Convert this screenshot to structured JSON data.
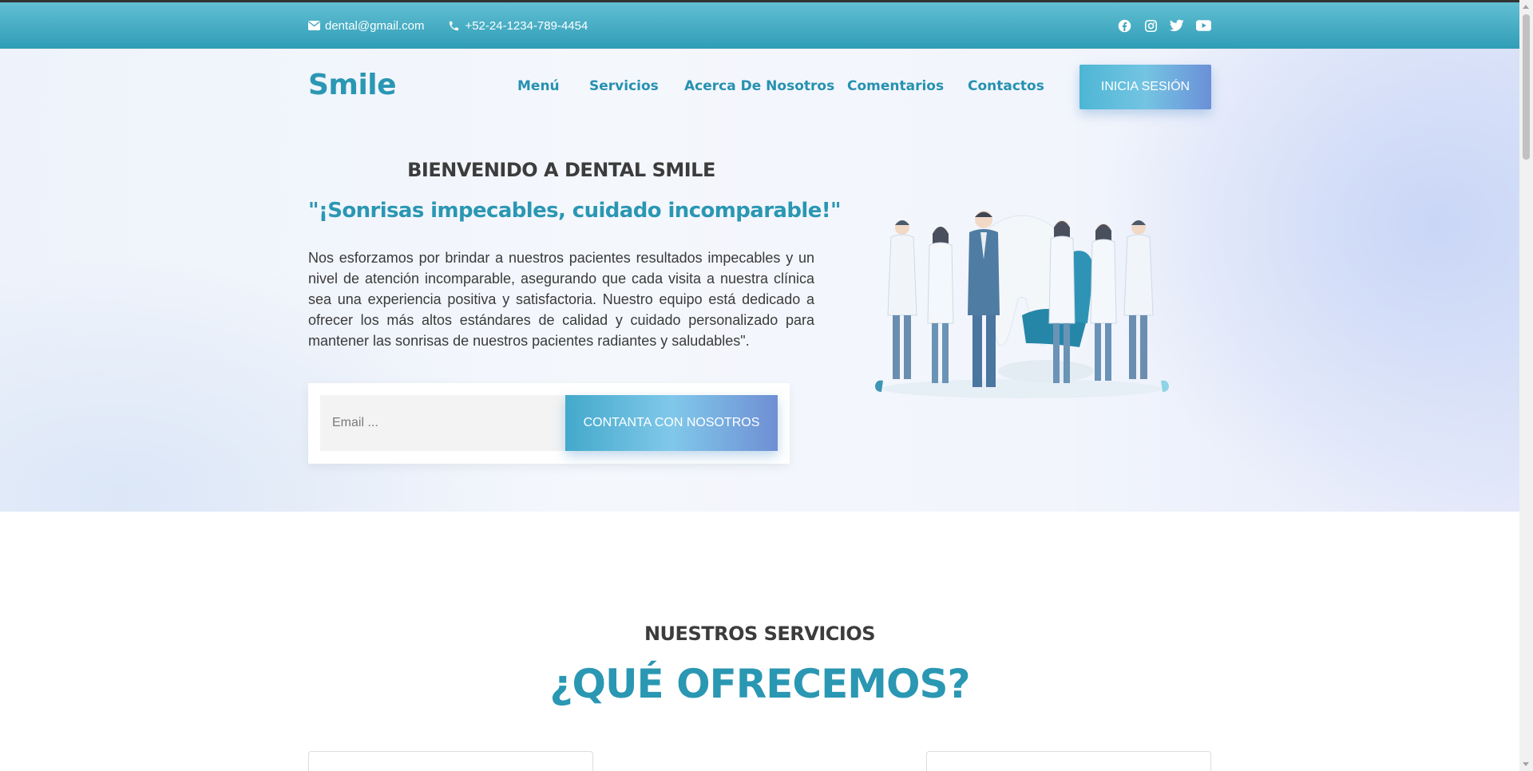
{
  "topbar": {
    "email": "dental@gmail.com",
    "phone": "+52-24-1234-789-4454",
    "social_icons": [
      "facebook-icon",
      "instagram-icon",
      "twitter-icon",
      "youtube-icon"
    ]
  },
  "header": {
    "logo": "Smile",
    "nav": [
      "Menú",
      "Servicios",
      "Acerca De Nosotros",
      "Comentarios",
      "Contactos"
    ],
    "login_label": "INICIA SESIÓN"
  },
  "hero": {
    "welcome": "BIENVENIDO A DENTAL SMILE",
    "slogan": "\"¡Sonrisas impecables, cuidado incomparable!\"",
    "description": "Nos esforzamos por brindar a nuestros pacientes resultados impecables y un nivel de atención incomparable, asegurando que cada visita a nuestra clínica sea una experiencia positiva y satisfactoria. Nuestro equipo está dedicado a ofrecer los más altos estándares de calidad y cuidado personalizado para mantener las sonrisas de nuestros pacientes radiantes y saludables\".",
    "email_placeholder": "Email ...",
    "cta_label": "CONTANTA CON NOSOTROS"
  },
  "services": {
    "eyebrow": "NUESTROS SERVICIOS",
    "title": "¿QUÉ OFRECEMOS?"
  },
  "colors": {
    "brand": "#2a97b3",
    "topbar": "#3ea7c0",
    "text_dark": "#3c3c3c"
  }
}
